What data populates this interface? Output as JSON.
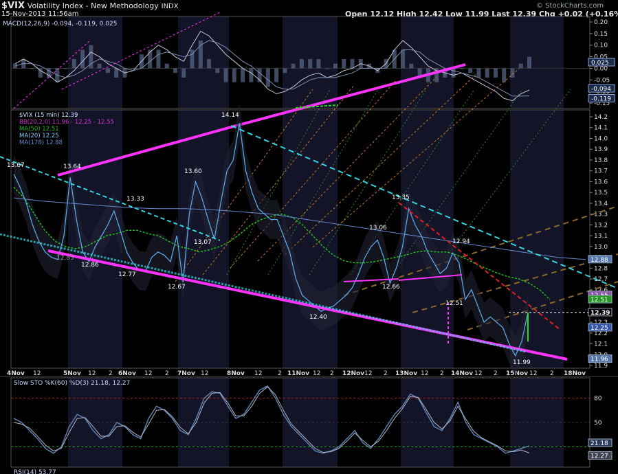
{
  "header": {
    "symbol": "$VIX",
    "name": "Volatility Index - New Methodology",
    "exchange": "INDX",
    "datetime": "15-Nov-2013 11:56am",
    "quote": "Open 12.12  High 12.42  Low 11.99  Last 12.39  Chg +0.02 (+0.16%)",
    "copyright": "© StockCharts.com"
  },
  "colors": {
    "background": "#000000",
    "panel_alt": "#141428",
    "price": "#5aa7e6",
    "trend_magenta": "#ff33ff",
    "trend_cyan": "#33d6e0",
    "red": "#e02020",
    "ma50": "#22bb22",
    "ma20": "#88ccff",
    "ma178": "#6688cc",
    "fan_orange": "#cc7722",
    "fan_green": "#2a8a2a"
  },
  "chart_data": [
    {
      "type": "line",
      "panel": "MACD",
      "legend": "MACD(12,26,9) -0.094, -0.119, 0.025",
      "ylim": [
        -0.15,
        0.2
      ],
      "y_ticks": [
        "0.20",
        "0.15",
        "0.10",
        "0.05",
        "0.00",
        "-0.05",
        "-0.10",
        "-0.15"
      ],
      "tags": [
        "0.025",
        "-0.094",
        "-0.119"
      ],
      "series": [
        {
          "values": [
            0.02,
            0.04,
            0.02,
            -0.01,
            -0.03,
            -0.06,
            -0.04,
            -0.01,
            0.03,
            0.07,
            0.05,
            0.02,
            0.0,
            -0.02,
            -0.01,
            0.03,
            0.07,
            0.1,
            0.08,
            0.05,
            0.03,
            0.1,
            0.16,
            0.14,
            0.1,
            0.06,
            0.03,
            0.0,
            -0.02,
            -0.05,
            -0.09,
            -0.11,
            -0.1,
            -0.08,
            -0.05,
            -0.03,
            -0.02,
            -0.04,
            -0.03,
            -0.01,
            0.0,
            0.02,
            0.01,
            -0.01,
            0.02,
            0.08,
            0.12,
            0.09,
            0.05,
            0.01,
            -0.01,
            -0.02,
            -0.03,
            -0.02,
            -0.04,
            -0.06,
            -0.08,
            -0.1,
            -0.13,
            -0.14,
            -0.11,
            -0.094
          ]
        },
        {
          "values": [
            0.01,
            0.02,
            0.02,
            0.01,
            -0.01,
            -0.03,
            -0.04,
            -0.03,
            -0.01,
            0.02,
            0.04,
            0.03,
            0.02,
            0.0,
            -0.01,
            0.0,
            0.03,
            0.06,
            0.07,
            0.06,
            0.05,
            0.06,
            0.1,
            0.12,
            0.11,
            0.09,
            0.06,
            0.03,
            0.01,
            -0.02,
            -0.05,
            -0.08,
            -0.09,
            -0.09,
            -0.07,
            -0.05,
            -0.04,
            -0.04,
            -0.04,
            -0.03,
            -0.02,
            0.0,
            0.0,
            0.0,
            0.0,
            0.04,
            0.08,
            0.08,
            0.07,
            0.04,
            0.02,
            0.0,
            -0.01,
            -0.02,
            -0.03,
            -0.04,
            -0.06,
            -0.08,
            -0.1,
            -0.12,
            -0.12,
            -0.119
          ]
        }
      ]
    },
    {
      "type": "line",
      "panel": "Price",
      "legend": [
        "$VIX (15 min) 12.39",
        "BB(20,2.0) 11.96 - 12.25 - 12.55",
        "MA(50) 12.51",
        "MA(20) 12.25",
        "MA(178) 12.88"
      ],
      "ylim": [
        11.9,
        14.2
      ],
      "y_ticks": [
        "14.2",
        "14.1",
        "14.0",
        "13.9",
        "13.8",
        "13.7",
        "13.6",
        "13.5",
        "13.4",
        "13.3",
        "13.2",
        "13.1",
        "13.0",
        "12.9",
        "12.8",
        "12.7",
        "12.6",
        "12.5",
        "12.4",
        "12.3",
        "12.2",
        "12.1",
        "12.0",
        "11.9"
      ],
      "x_labels": [
        "4Nov",
        "12",
        "5Nov",
        "12",
        "2",
        "6Nov",
        "12",
        "2",
        "7Nov",
        "12",
        "8Nov",
        "12",
        "2",
        "11Nov",
        "12",
        "2",
        "12Nov",
        "12",
        "2",
        "13Nov",
        "12",
        "2",
        "14Nov",
        "12",
        "2",
        "15Nov",
        "12",
        "2",
        "18Nov"
      ],
      "annotations": [
        "13.67",
        "13.64",
        "13.33",
        "13.60",
        "14.14",
        "13.07",
        "12.86",
        "12.77",
        "12.67",
        "12.40",
        "13.35",
        "13.06",
        "12.66",
        "12.94",
        "12.51",
        "11.99"
      ],
      "tags": [
        "12.88",
        "12.55",
        "12.51",
        "12.39",
        "12.25",
        "11.96"
      ],
      "series": [
        {
          "name": "$VIX",
          "values": [
            13.67,
            13.55,
            13.4,
            13.2,
            13.05,
            12.95,
            12.9,
            12.88,
            13.1,
            13.64,
            13.25,
            12.95,
            12.86,
            13.0,
            13.1,
            13.2,
            13.33,
            13.15,
            12.95,
            12.85,
            12.78,
            12.77,
            12.9,
            12.95,
            12.92,
            12.86,
            13.1,
            12.67,
            13.3,
            13.6,
            13.45,
            13.25,
            13.07,
            13.4,
            13.7,
            13.8,
            14.14,
            13.7,
            13.5,
            13.35,
            13.3,
            13.25,
            13.25,
            13.1,
            12.95,
            12.7,
            12.55,
            12.5,
            12.45,
            12.4,
            12.43,
            12.45,
            12.5,
            12.55,
            12.62,
            12.75,
            12.9,
            13.0,
            13.06,
            12.9,
            12.66,
            12.8,
            13.0,
            13.35,
            13.2,
            13.1,
            12.95,
            12.85,
            12.75,
            12.8,
            12.94,
            12.85,
            12.51,
            12.6,
            12.45,
            12.3,
            12.35,
            12.3,
            12.25,
            12.1,
            11.99,
            12.12,
            12.39
          ]
        },
        {
          "name": "MA(50)",
          "values": [
            13.55,
            13.45,
            13.3,
            13.15,
            13.05,
            13.0,
            12.98,
            13.0,
            13.05,
            13.1,
            13.12,
            13.15,
            13.15,
            13.12,
            13.1,
            13.05,
            13.0,
            12.98,
            12.95,
            12.97,
            13.0,
            13.05,
            13.12,
            13.2,
            13.25,
            13.28,
            13.3,
            13.27,
            13.2,
            13.1,
            13.0,
            12.92,
            12.87,
            12.85,
            12.85,
            12.86,
            12.88,
            12.9,
            12.92,
            12.95,
            12.96,
            12.95,
            12.95,
            12.92,
            12.88,
            12.83,
            12.79,
            12.75,
            12.72,
            12.7,
            12.66,
            12.6,
            12.51
          ]
        },
        {
          "name": "MA(178)",
          "values": [
            13.45,
            13.42,
            13.4,
            13.38,
            13.36,
            13.35,
            13.35,
            13.34,
            13.32,
            13.3,
            13.26,
            13.22,
            13.18,
            13.14,
            13.1,
            13.06,
            13.02,
            12.98,
            12.94,
            12.9,
            12.88
          ]
        }
      ]
    },
    {
      "type": "line",
      "panel": "Slow STO",
      "legend": "Slow STO %K(60) %D(3) 21.18, 12.27",
      "ylim": [
        0,
        100
      ],
      "y_ticks": [
        "80",
        "50"
      ],
      "tags": [
        "21.18",
        "12.27"
      ],
      "series": [
        {
          "values": [
            55,
            50,
            40,
            30,
            18,
            12,
            20,
            45,
            60,
            55,
            40,
            30,
            35,
            50,
            45,
            35,
            30,
            55,
            70,
            65,
            55,
            40,
            35,
            55,
            80,
            88,
            86,
            70,
            55,
            60,
            75,
            90,
            95,
            80,
            60,
            45,
            35,
            25,
            15,
            12,
            15,
            20,
            30,
            40,
            25,
            18,
            30,
            45,
            60,
            70,
            85,
            80,
            62,
            45,
            40,
            55,
            75,
            50,
            35,
            30,
            25,
            20,
            12,
            15,
            18,
            21.18
          ]
        },
        {
          "values": [
            50,
            48,
            43,
            33,
            22,
            15,
            18,
            38,
            55,
            56,
            45,
            33,
            33,
            45,
            46,
            38,
            32,
            48,
            65,
            66,
            57,
            44,
            36,
            50,
            74,
            86,
            87,
            74,
            58,
            58,
            70,
            86,
            94,
            84,
            65,
            48,
            38,
            28,
            18,
            13,
            14,
            18,
            27,
            37,
            28,
            20,
            27,
            40,
            55,
            67,
            82,
            81,
            66,
            50,
            42,
            52,
            70,
            54,
            39,
            31,
            26,
            21,
            15,
            14,
            16,
            12.27
          ]
        }
      ]
    },
    {
      "type": "line",
      "panel": "RSI",
      "legend": "RSI(14) 53.77"
    }
  ]
}
